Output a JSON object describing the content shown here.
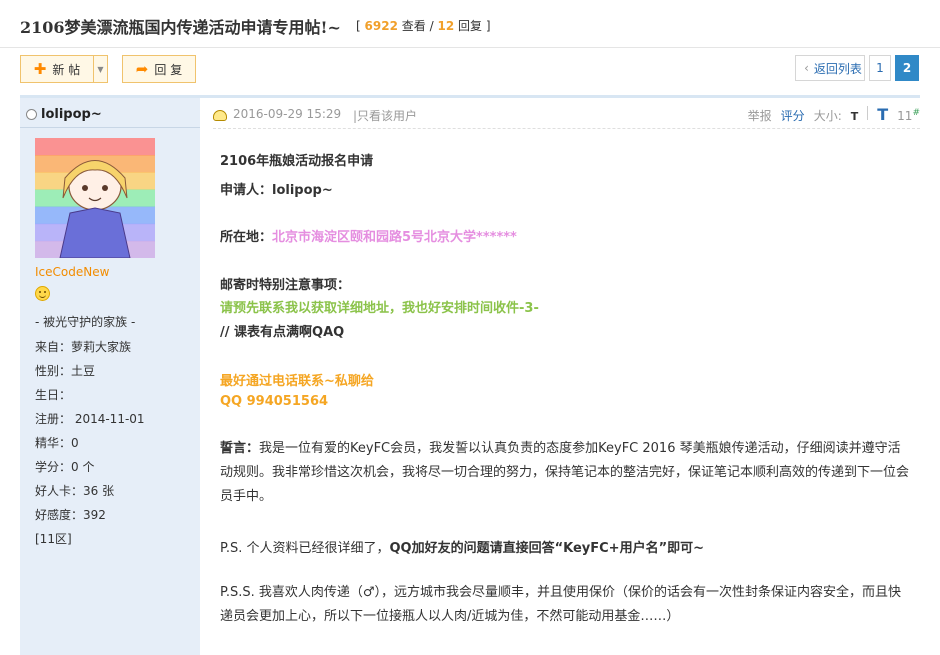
{
  "thread": {
    "title": "2106梦美漂流瓶国内传递活动申请专用帖!~",
    "stats_open": "[",
    "views": "6922",
    "views_label": "查看",
    "sep": "/",
    "replies": "12",
    "replies_label": "回复",
    "stats_close": "]"
  },
  "toolbar": {
    "new_post_label": "新 帖",
    "reply_label": "回 复",
    "back_to_list": "返回列表",
    "pages": [
      "1",
      "2"
    ],
    "current_page": "2"
  },
  "author": {
    "name": "lolipop~",
    "group": "IceCodeNew",
    "family": "- 被光守护的家族 -",
    "info": [
      "来自：萝莉大家族",
      "性别：土豆",
      "生日：",
      "注册：  2014-11-01",
      "精华：0",
      "学分：0 个",
      "好人卡：36 张",
      "好感度：392",
      "[11区]"
    ],
    "avatar_colors": [
      "#ff6b6b",
      "#ff9f43",
      "#feca57",
      "#7bed9f",
      "#70a1ff",
      "#a29bfe",
      "#c8a2e8"
    ]
  },
  "post": {
    "time": "2016-09-29 15:29",
    "only_author": "|只看该用户",
    "report": "举报",
    "rate": "评分",
    "font_size_label": "大小:",
    "font_small": "T",
    "font_large": "T",
    "floor": "11",
    "floor_mark": "#",
    "heading": "2106年瓶娘活动报名申请",
    "applicant": "申请人：lolipop~",
    "location_label": "所在地：",
    "location_value": "北京市海淀区颐和园路5号北京大学******",
    "notice_label": "邮寄时特别注意事项：",
    "notice_green": "请预先联系我以获取详细地址，我也好安排时间收件-3-",
    "notice_extra": "//  课表有点满啊QAQ",
    "contact1": "最好通过电话联系~私聊给",
    "contact2": "QQ 994051564",
    "oath_label": "誓言：",
    "oath_text": "我是一位有爱的KeyFC会员，我发誓以认真负责的态度参加KeyFC 2016 琴美瓶娘传递活动，仔细阅读并遵守活动规则。我非常珍惜这次机会，我将尽一切合理的努力，保持笔记本的整洁完好，保证笔记本顺利高效的传递到下一位会员手中。",
    "ps_prefix": "P.S.  个人资料已经很详细了，",
    "ps_bold": "QQ加好友的问题请直接回答“KeyFC+用户名”即可~",
    "pss_text": "P.S.S. 我喜欢人肉传递（♂），远方城市我会尽量顺丰，并且使用保价（保价的话会有一次性封条保证内容安全，而且快递员会更加上心，所以下一位接瓶人以人肉/近城为佳，不然可能动用基金……）"
  }
}
